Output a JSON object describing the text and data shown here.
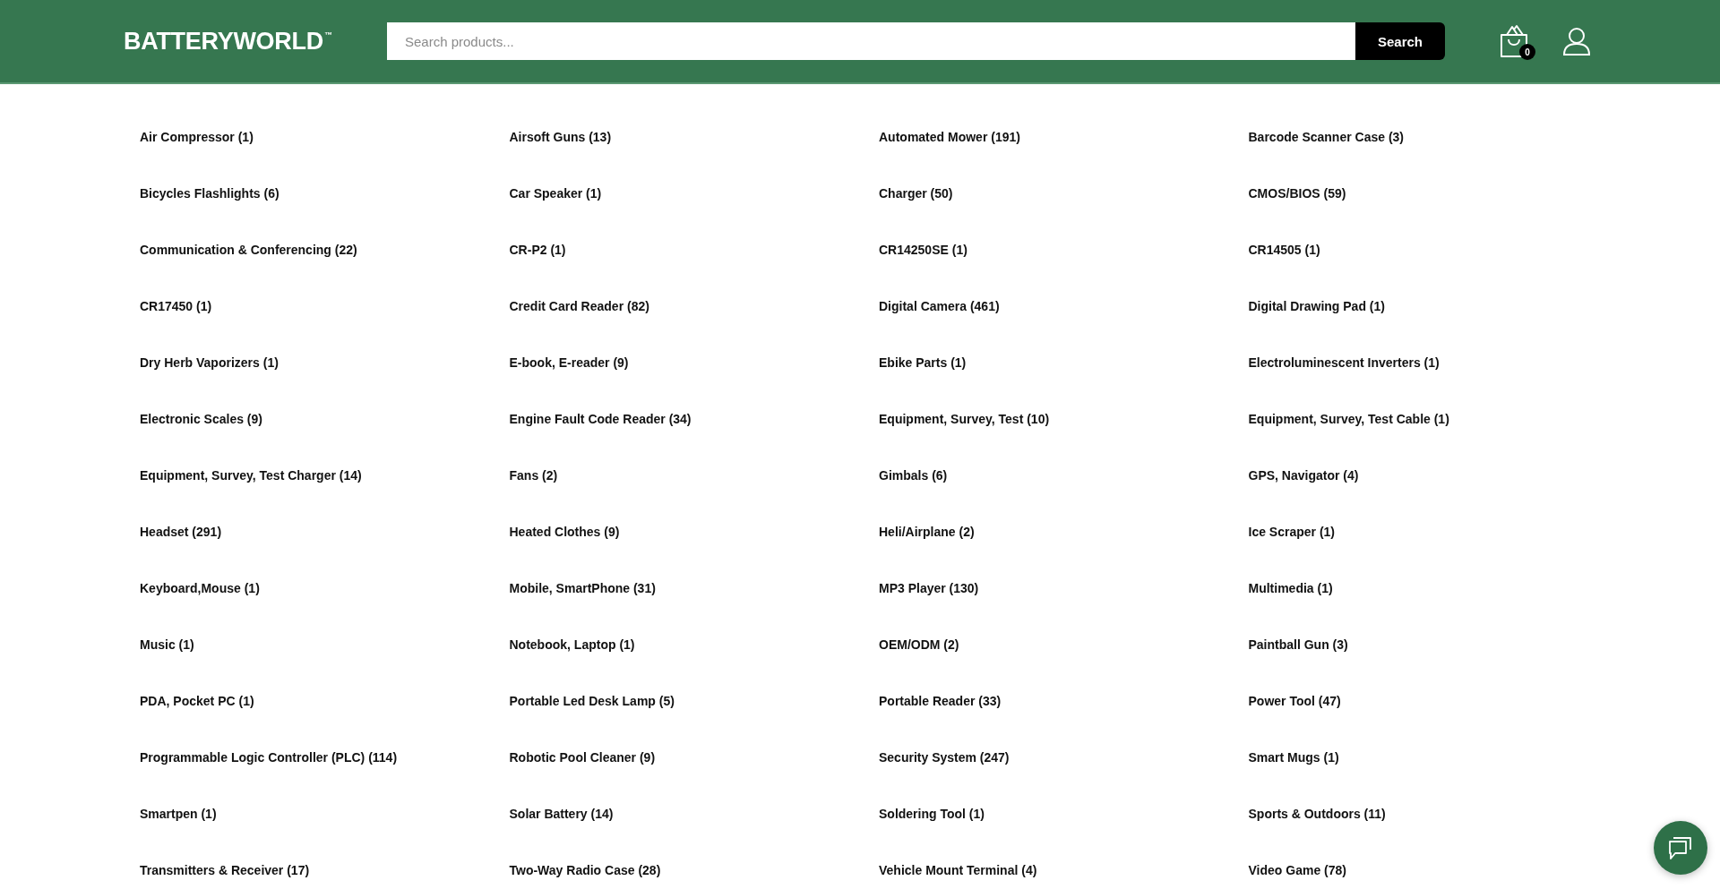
{
  "header": {
    "logo": "BATTERYWORLD$^{™}$",
    "search": {
      "placeholder": "Search products...",
      "button": "Search"
    },
    "cart": {
      "count": "0"
    }
  },
  "categories": [
    {
      "label": "Air Compressor (1)"
    },
    {
      "label": "Airsoft Guns (13)"
    },
    {
      "label": "Automated Mower (191)"
    },
    {
      "label": "Barcode Scanner Case (3)"
    },
    {
      "label": "Bicycles Flashlights (6)"
    },
    {
      "label": "Car Speaker (1)"
    },
    {
      "label": "Charger (50)"
    },
    {
      "label": "CMOS/BIOS (59)"
    },
    {
      "label": "Communication & Conferencing (22)"
    },
    {
      "label": "CR-P2 (1)"
    },
    {
      "label": "CR14250SE (1)"
    },
    {
      "label": "CR14505 (1)"
    },
    {
      "label": "CR17450 (1)"
    },
    {
      "label": "Credit Card Reader (82)"
    },
    {
      "label": "Digital Camera (461)"
    },
    {
      "label": "Digital Drawing Pad (1)"
    },
    {
      "label": "Dry Herb Vaporizers (1)"
    },
    {
      "label": "E-book, E-reader (9)"
    },
    {
      "label": "Ebike Parts (1)"
    },
    {
      "label": "Electroluminescent Inverters (1)"
    },
    {
      "label": "Electronic Scales (9)"
    },
    {
      "label": "Engine Fault Code Reader (34)"
    },
    {
      "label": "Equipment, Survey, Test (10)"
    },
    {
      "label": "Equipment, Survey, Test Cable (1)"
    },
    {
      "label": "Equipment, Survey, Test Charger (14)"
    },
    {
      "label": "Fans (2)"
    },
    {
      "label": "Gimbals (6)"
    },
    {
      "label": "GPS, Navigator (4)"
    },
    {
      "label": "Headset (291)"
    },
    {
      "label": "Heated Clothes (9)"
    },
    {
      "label": "Heli/Airplane (2)"
    },
    {
      "label": "Ice Scraper (1)"
    },
    {
      "label": "Keyboard,Mouse (1)"
    },
    {
      "label": "Mobile, SmartPhone (31)"
    },
    {
      "label": "MP3 Player (130)"
    },
    {
      "label": "Multimedia (1)"
    },
    {
      "label": "Music (1)"
    },
    {
      "label": "Notebook, Laptop (1)"
    },
    {
      "label": "OEM/ODM (2)"
    },
    {
      "label": "Paintball Gun (3)"
    },
    {
      "label": "PDA, Pocket PC (1)"
    },
    {
      "label": "Portable Led Desk Lamp (5)"
    },
    {
      "label": "Portable Reader (33)"
    },
    {
      "label": "Power Tool (47)"
    },
    {
      "label": "Programmable Logic Controller (PLC) (114)"
    },
    {
      "label": "Robotic Pool Cleaner (9)"
    },
    {
      "label": "Security System (247)"
    },
    {
      "label": "Smart Mugs (1)"
    },
    {
      "label": "Smartpen (1)"
    },
    {
      "label": "Solar Battery (14)"
    },
    {
      "label": "Soldering Tool (1)"
    },
    {
      "label": "Sports & Outdoors (11)"
    },
    {
      "label": "Transmitters & Receiver (17)"
    },
    {
      "label": "Two-Way Radio Case (28)"
    },
    {
      "label": "Vehicle Mount Terminal (4)"
    },
    {
      "label": "Video Game (78)"
    }
  ]
}
